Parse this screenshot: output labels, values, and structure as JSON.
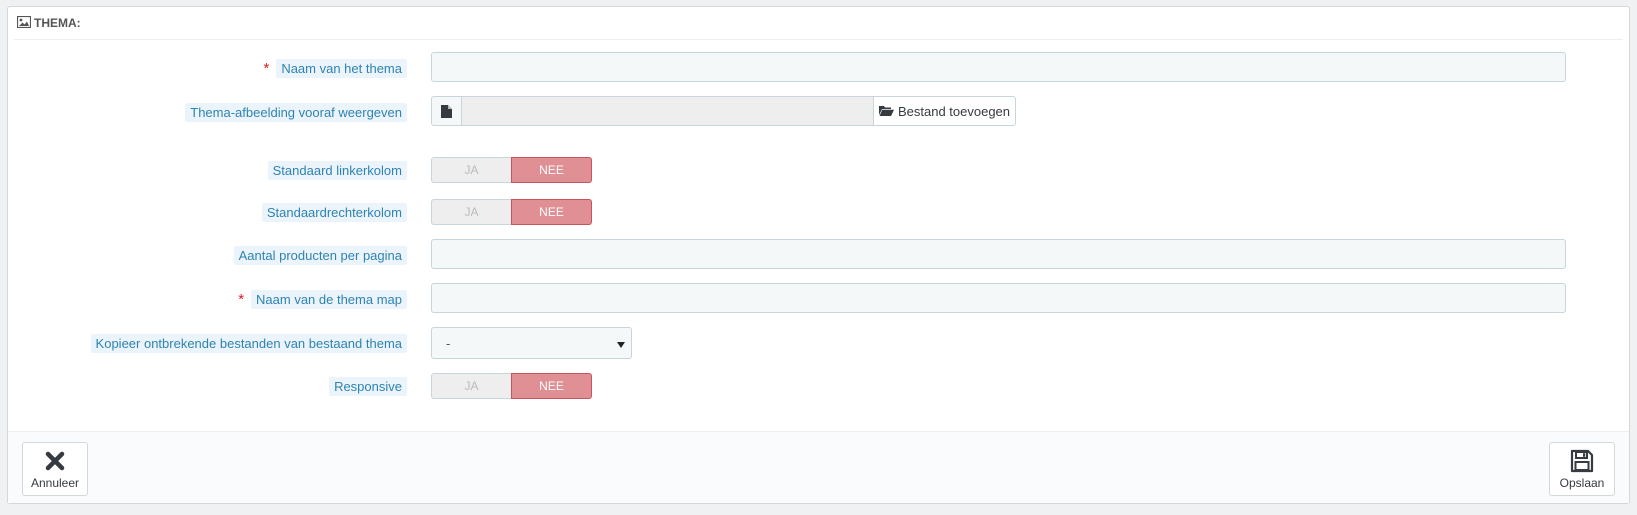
{
  "panel": {
    "title": "THEMA:",
    "icon": "image-icon"
  },
  "fields": {
    "theme_name": {
      "label": "Naam van het thema",
      "required": true,
      "value": ""
    },
    "preview_image": {
      "label": "Thema-afbeelding vooraf weergeven",
      "button_label": "Bestand toevoegen",
      "file_icon": "file-icon",
      "button_icon": "folder-open-icon",
      "value": ""
    },
    "left_column": {
      "label": "Standaard linkerkolom",
      "yes": "JA",
      "no": "NEE",
      "selected": "NEE"
    },
    "right_column": {
      "label": "Standaardrechterkolom",
      "yes": "JA",
      "no": "NEE",
      "selected": "NEE"
    },
    "products_per_page": {
      "label": "Aantal producten per pagina",
      "value": ""
    },
    "theme_dir": {
      "label": "Naam van de thema map",
      "required": true,
      "value": ""
    },
    "copy_missing": {
      "label": "Kopieer ontbrekende bestanden van bestaand thema",
      "selected": "-"
    },
    "responsive": {
      "label": "Responsive",
      "yes": "JA",
      "no": "NEE",
      "selected": "NEE"
    }
  },
  "footer": {
    "cancel_label": "Annuleer",
    "cancel_icon": "close-icon",
    "save_label": "Opslaan",
    "save_icon": "save-icon"
  },
  "colors": {
    "label_text": "#2e83b2",
    "label_bg": "#ecf4fb",
    "required": "#e01b1b",
    "switch_off": "#e08f95"
  }
}
